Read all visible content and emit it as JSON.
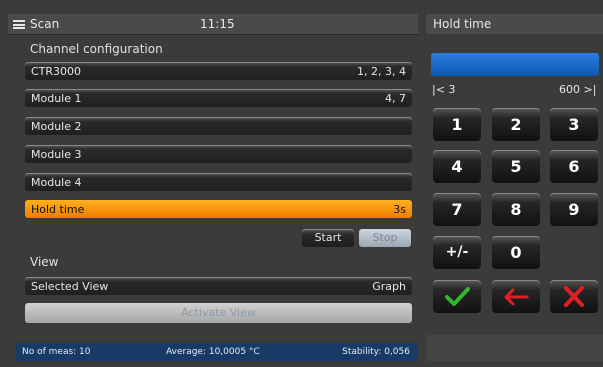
{
  "topbar": {
    "app_title": "Scan",
    "time": "11:15"
  },
  "right_header": {
    "title": "Hold time"
  },
  "channel_config": {
    "heading": "Channel configuration",
    "rows": [
      {
        "label": "CTR3000",
        "value": "1, 2, 3, 4"
      },
      {
        "label": "Module 1",
        "value": "4, 7"
      },
      {
        "label": "Module 2",
        "value": ""
      },
      {
        "label": "Module 3",
        "value": ""
      },
      {
        "label": "Module 4",
        "value": ""
      }
    ],
    "hold_time": {
      "label": "Hold time",
      "value": "3s"
    }
  },
  "controls": {
    "start_label": "Start",
    "stop_label": "Stop"
  },
  "view": {
    "heading": "View",
    "selected_label": "Selected View",
    "selected_value": "Graph",
    "activate_label": "Activate View"
  },
  "status": {
    "meas": "No of meas: 10",
    "average": "Average: 10,0005 °C",
    "stability": "Stability: 0,056"
  },
  "keypad": {
    "range_min": "|< 3",
    "range_max": "600 >|",
    "keys": [
      "1",
      "2",
      "3",
      "4",
      "5",
      "6",
      "7",
      "8",
      "9",
      "+/-",
      "0"
    ],
    "icons": {
      "ok": "check-icon",
      "back": "arrow-left-icon",
      "cancel": "x-icon"
    }
  },
  "colors": {
    "accent_orange": "#f58a00",
    "blue": "#1a64c4",
    "status_bg": "#173a66",
    "ok_green": "#2fb82f",
    "red": "#e02020"
  }
}
